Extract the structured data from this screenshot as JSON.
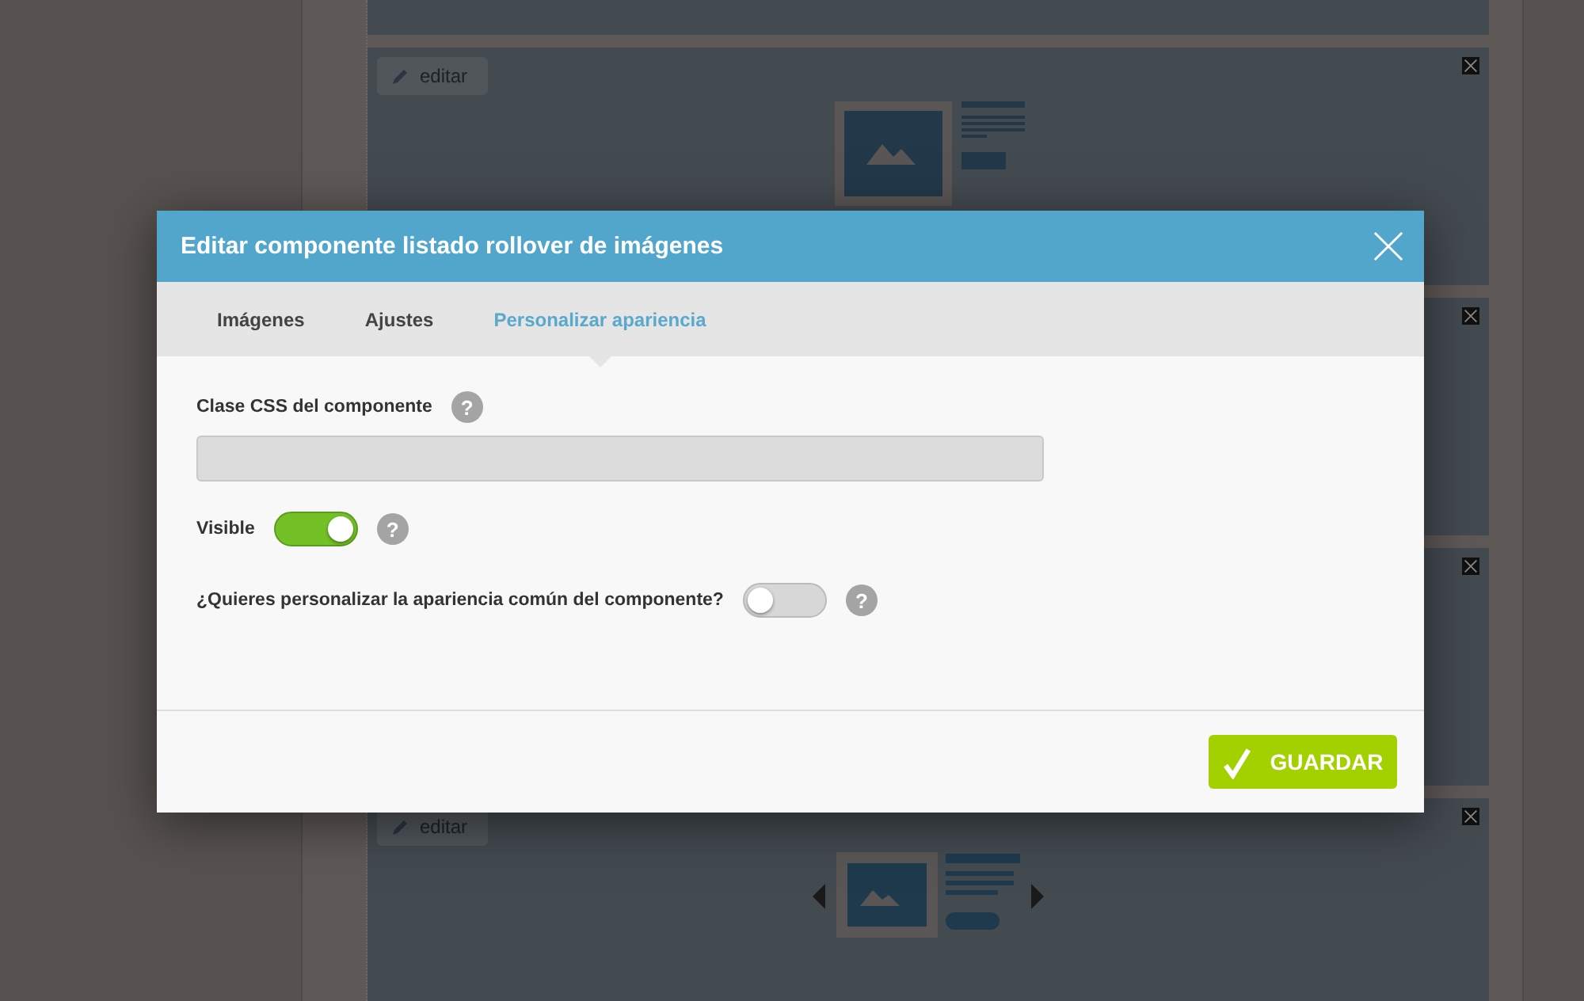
{
  "background_panels": [
    {
      "kind": "blank"
    },
    {
      "kind": "image-text",
      "edit_label": "editar"
    },
    {
      "kind": "covered"
    },
    {
      "kind": "covered"
    },
    {
      "kind": "carousel",
      "edit_label": "editar"
    }
  ],
  "dialog": {
    "title": "Editar componente listado rollover de imágenes",
    "tabs": [
      {
        "label": "Imágenes",
        "selected": false
      },
      {
        "label": "Ajustes",
        "selected": false
      },
      {
        "label": "Personalizar apariencia",
        "selected": true
      }
    ],
    "css_class": {
      "label": "Clase CSS del componente",
      "help": "?"
    },
    "visible": {
      "label": "Visible",
      "on": true,
      "help": "?"
    },
    "customize": {
      "label": "¿Quieres personalizar la apariencia común del componente?",
      "on": false,
      "help": "?"
    },
    "save_label": "GUARDAR"
  }
}
